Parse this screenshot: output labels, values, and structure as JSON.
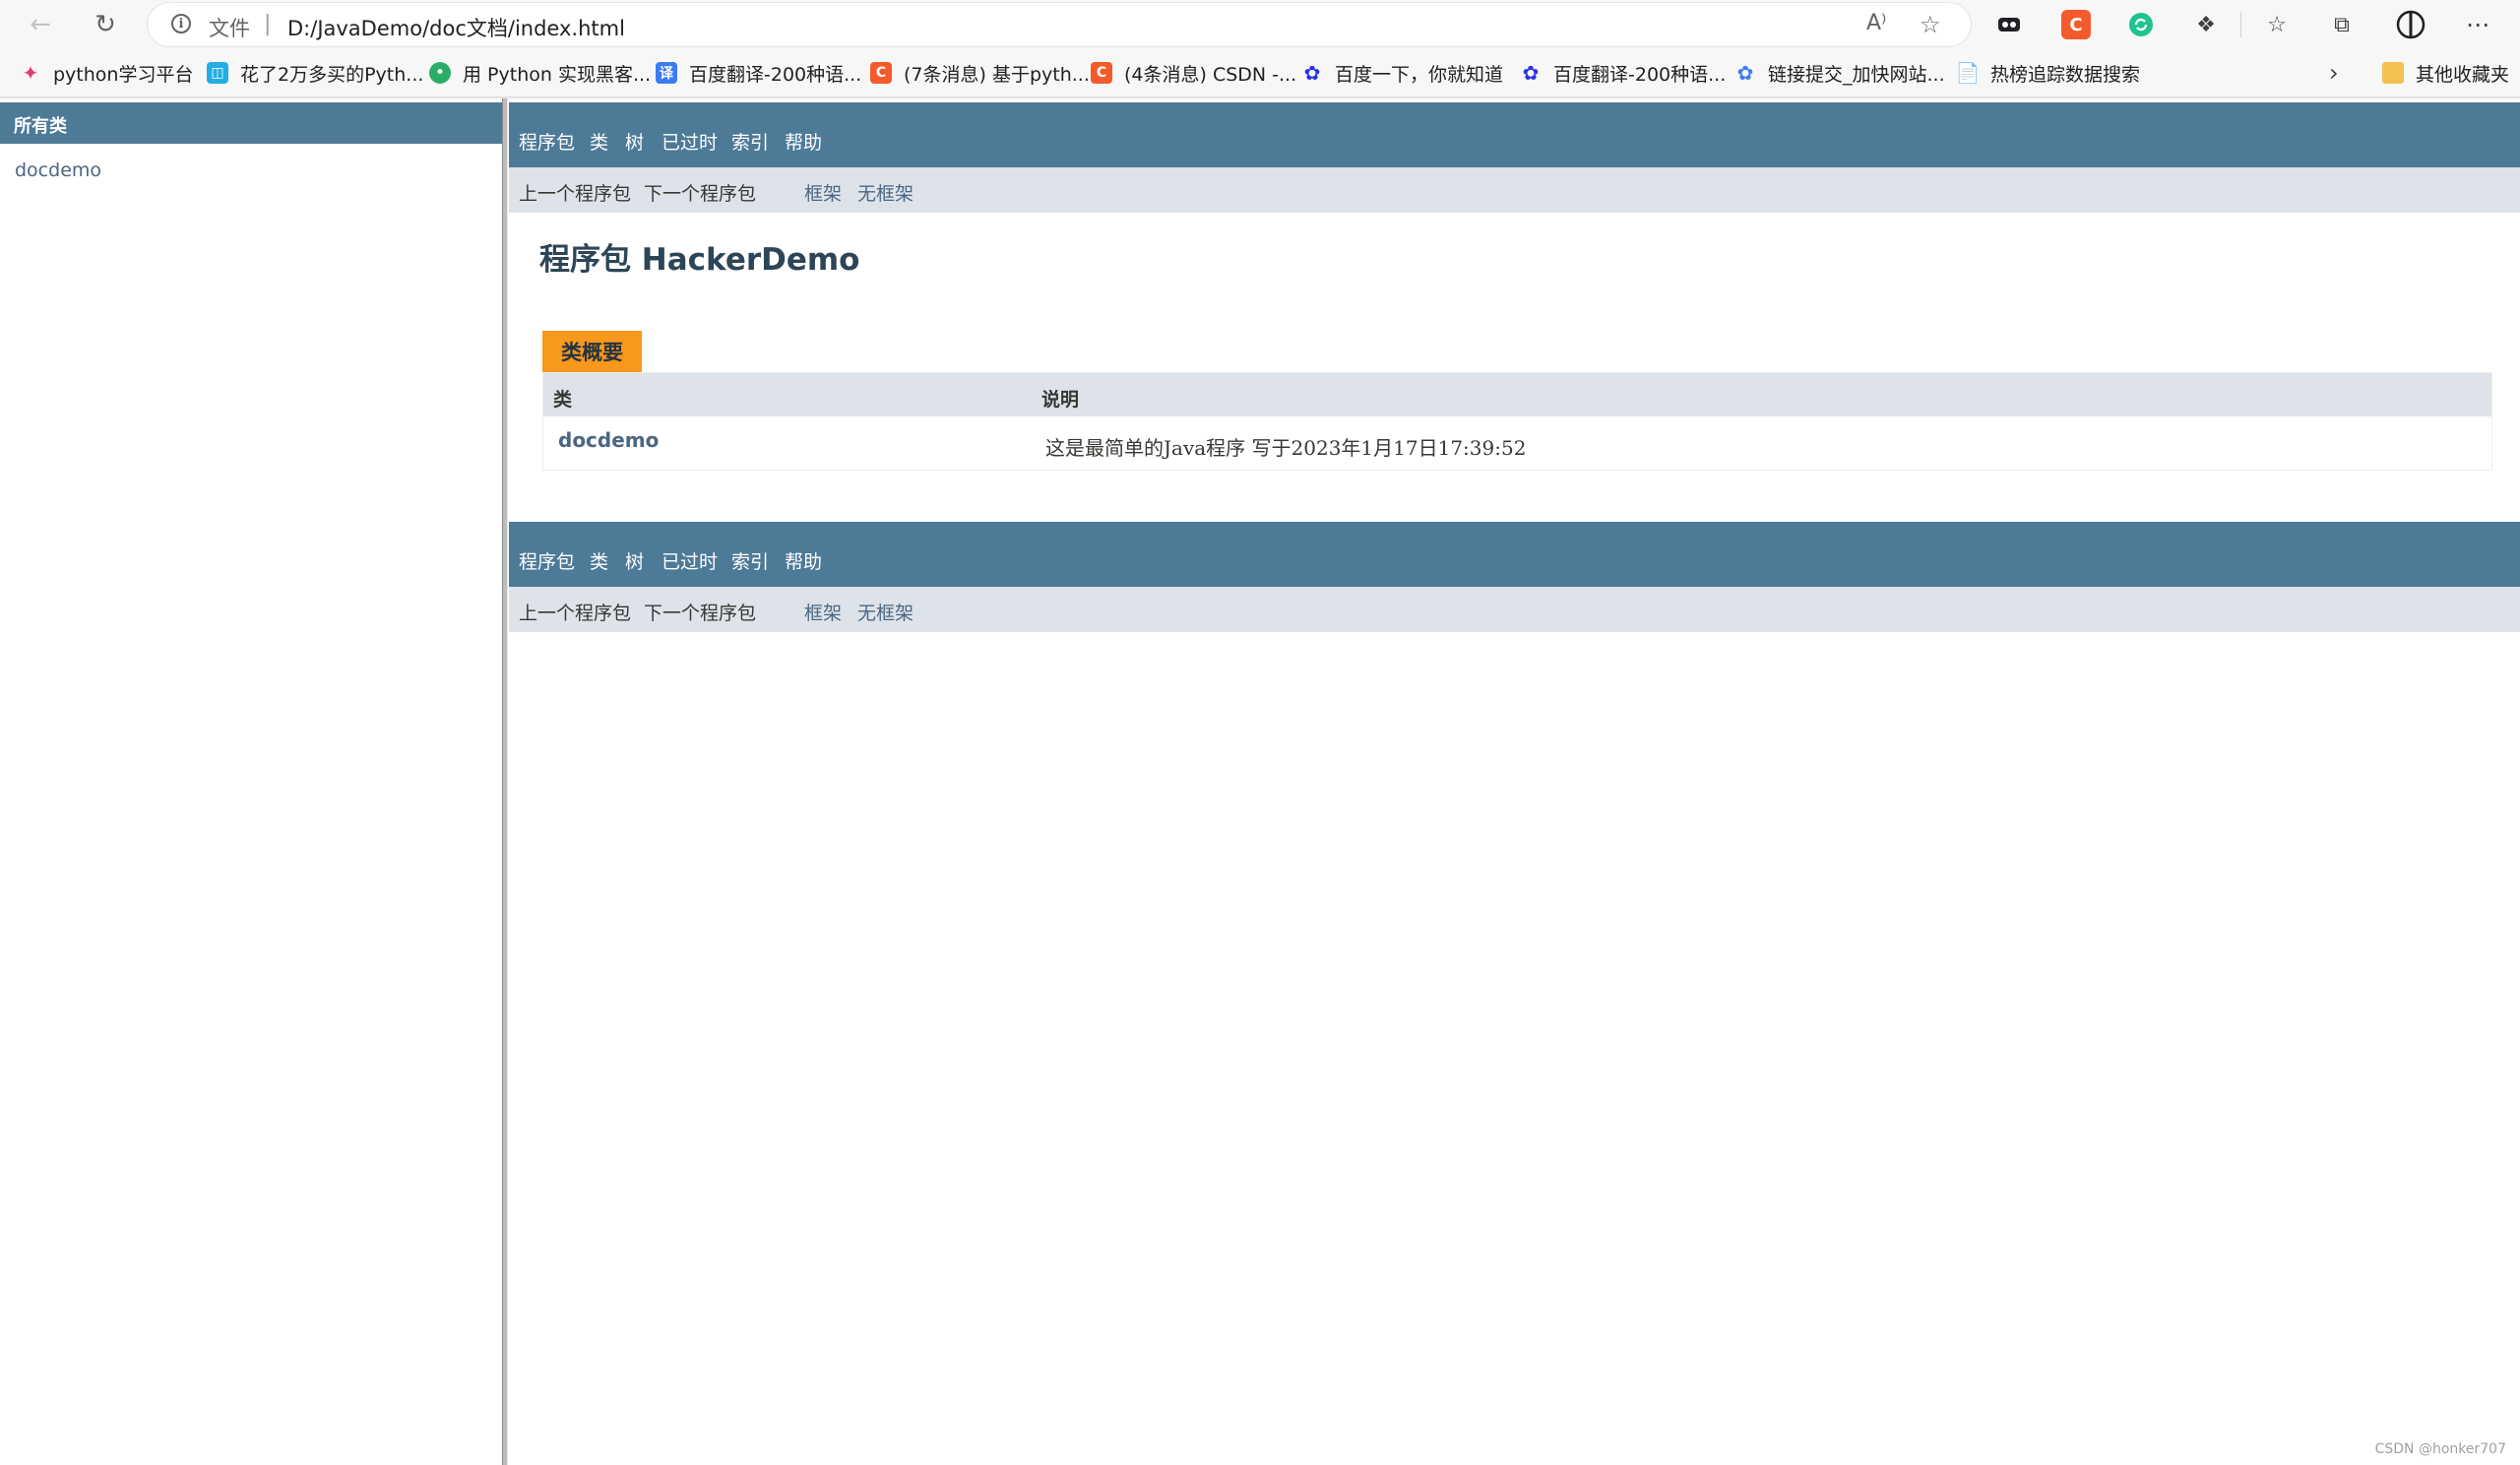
{
  "browser": {
    "address": {
      "scheme_label": "文件",
      "url": "D:/JavaDemo/doc文档/index.html"
    },
    "bookmarks": [
      {
        "label": "python学习平台",
        "icon": "python-platform-icon",
        "color": "#e03e6f"
      },
      {
        "label": "花了2万多买的Pyth...",
        "icon": "bilibili-icon",
        "color": "#23ade5"
      },
      {
        "label": "用 Python 实现黑客...",
        "icon": "wechat-icon",
        "color": "#2aae67"
      },
      {
        "label": "百度翻译-200种语...",
        "icon": "baidu-translate-icon",
        "color": "#3b7cf5"
      },
      {
        "label": "(7条消息) 基于pyth...",
        "icon": "csdn-icon",
        "color": "#f55a2c"
      },
      {
        "label": "(4条消息) CSDN -...",
        "icon": "csdn-icon",
        "color": "#f55a2c"
      },
      {
        "label": "百度一下，你就知道",
        "icon": "baidu-paw-icon",
        "color": "#2932e1"
      },
      {
        "label": "百度翻译-200种语...",
        "icon": "baidu-paw-icon",
        "color": "#2932e1"
      },
      {
        "label": "链接提交_加快网站...",
        "icon": "baidu-paw-icon",
        "color": "#3b7cf5"
      },
      {
        "label": "热榜追踪数据搜索",
        "icon": "page-icon",
        "color": "#3c4043"
      }
    ],
    "other_bookmarks": "其他收藏夹"
  },
  "left": {
    "header": "所有类",
    "links": [
      "docdemo"
    ]
  },
  "nav": {
    "top_items": [
      "程序包",
      "类",
      "树",
      "已过时",
      "索引",
      "帮助"
    ],
    "prev": "上一个程序包",
    "next": "下一个程序包",
    "frames": "框架",
    "noframes": "无框架"
  },
  "main": {
    "title": "程序包 HackerDemo",
    "summary_caption": "类概要",
    "columns": [
      "类",
      "说明"
    ],
    "rows": [
      {
        "class": "docdemo",
        "desc": "这是最简单的Java程序 写于2023年1月17日17:39:52"
      }
    ]
  },
  "watermark": "CSDN @honker707",
  "colors": {
    "nav_bar": "#4d7a97",
    "sub_nav": "#dee3e9",
    "caption": "#f8981d",
    "link": "#4a6782"
  }
}
